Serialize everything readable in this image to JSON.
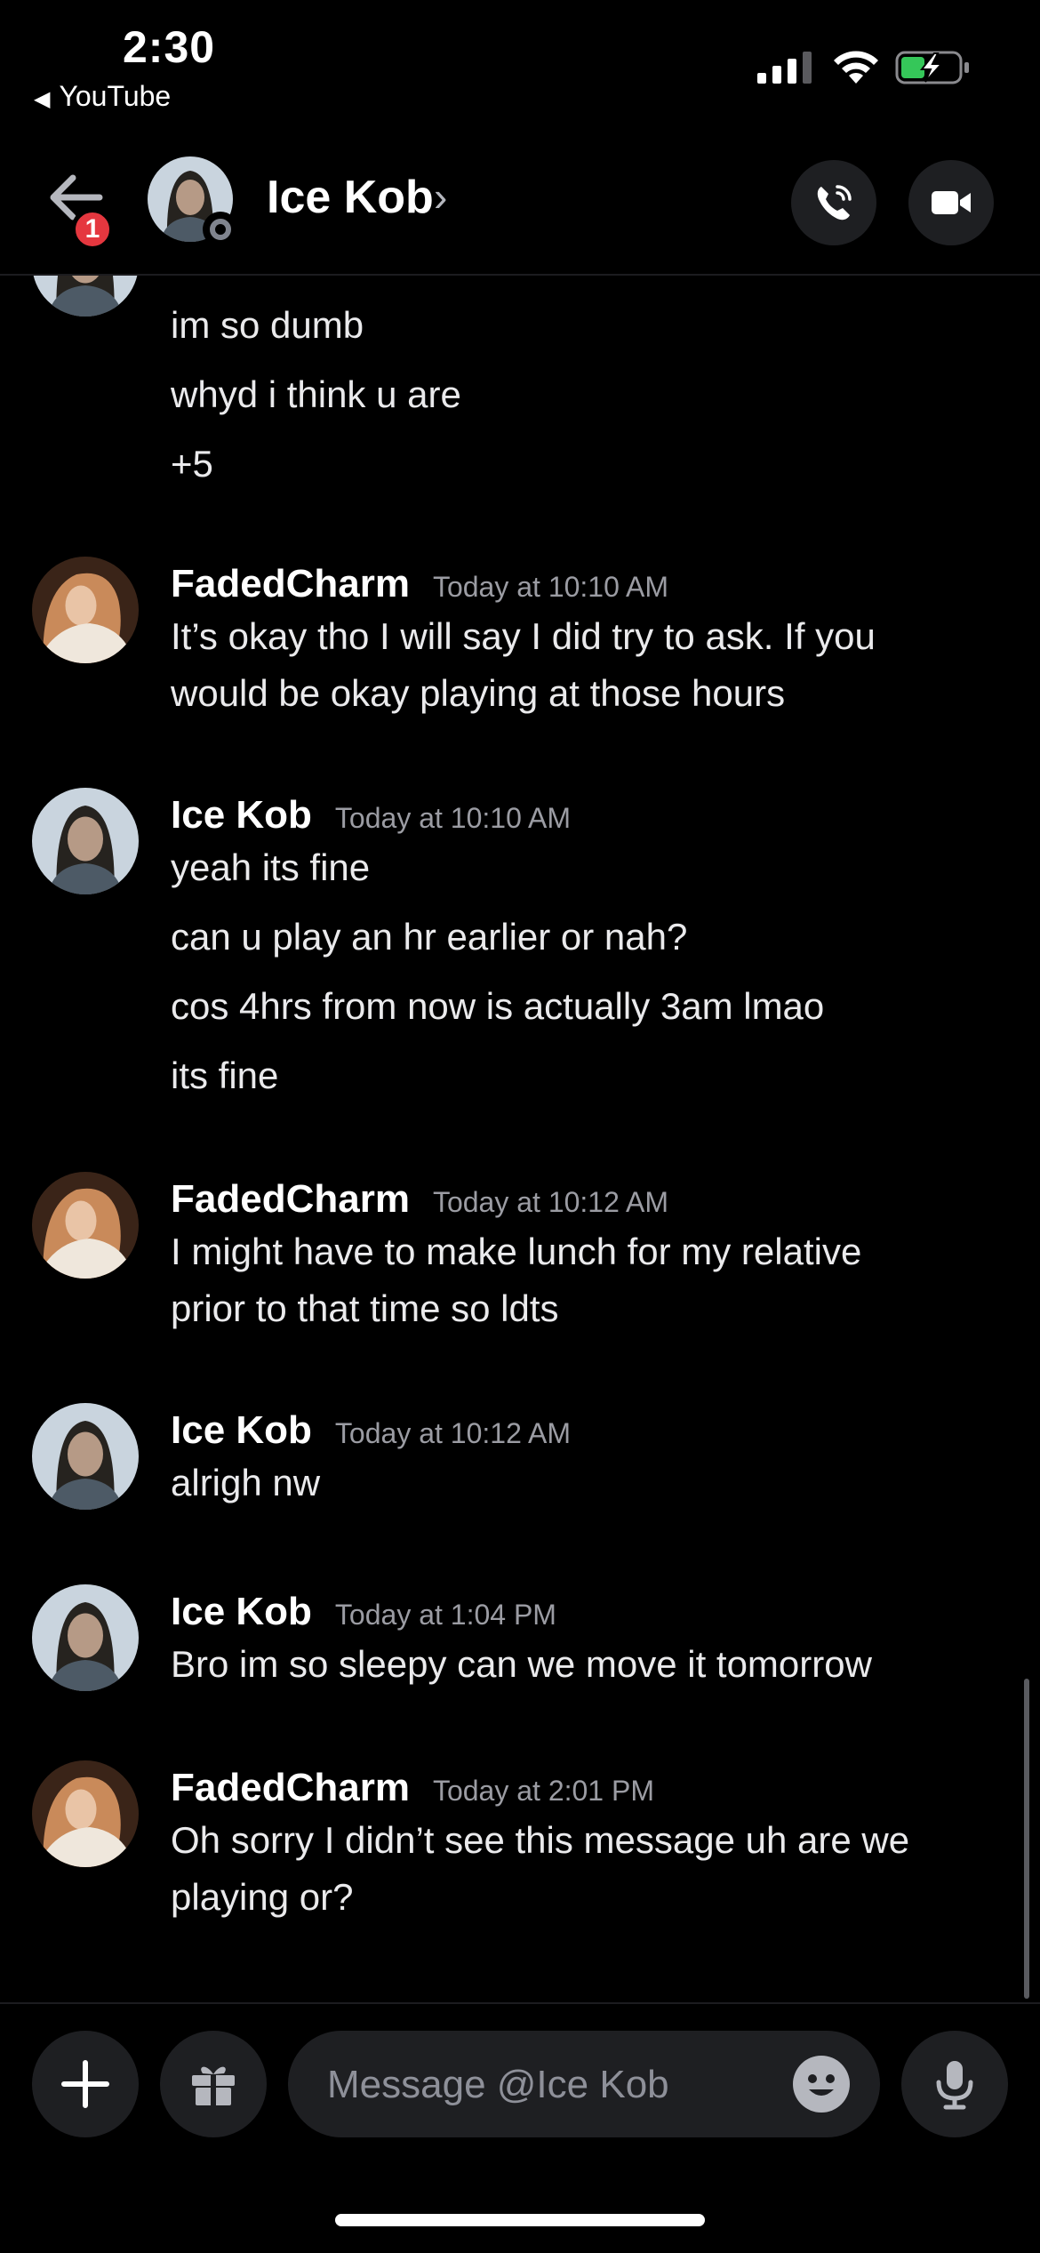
{
  "status_bar": {
    "time": "2:30",
    "back_app": "YouTube"
  },
  "header": {
    "name": "Ice Kob",
    "chevron": "›",
    "unread_badge": "1"
  },
  "messages": [
    {
      "continuation": true,
      "lines": [
        "im so dumb",
        "whyd i think u are",
        "+5"
      ]
    },
    {
      "author": "FadedCharm",
      "timestamp": "Today at 10:10 AM",
      "lines": [
        "It’s okay tho I will say I did try to ask. If you",
        "would be okay playing at those hours"
      ]
    },
    {
      "author": "Ice Kob",
      "timestamp": "Today at 10:10 AM",
      "lines": [
        "yeah its fine",
        "can u play an hr earlier or nah?",
        "cos 4hrs from now is actually 3am lmao",
        "its fine"
      ]
    },
    {
      "author": "FadedCharm",
      "timestamp": "Today at 10:12 AM",
      "lines": [
        "I might have to make lunch for my relative",
        "prior to that time so ldts"
      ]
    },
    {
      "author": "Ice Kob",
      "timestamp": "Today at 10:12 AM",
      "lines": [
        "alrigh nw"
      ]
    },
    {
      "author": "Ice Kob",
      "timestamp": "Today at 1:04 PM",
      "lines": [
        "Bro im so sleepy can we move it tomorrow"
      ]
    },
    {
      "author": "FadedCharm",
      "timestamp": "Today at 2:01 PM",
      "lines": [
        "Oh sorry I didn’t see this message uh are we",
        "playing or?"
      ]
    }
  ],
  "composer": {
    "placeholder": "Message @Ice Kob"
  },
  "icons": [
    "back-arrow-icon",
    "phone-icon",
    "video-camera-icon",
    "plus-icon",
    "gift-icon",
    "emoji-icon",
    "microphone-icon"
  ]
}
